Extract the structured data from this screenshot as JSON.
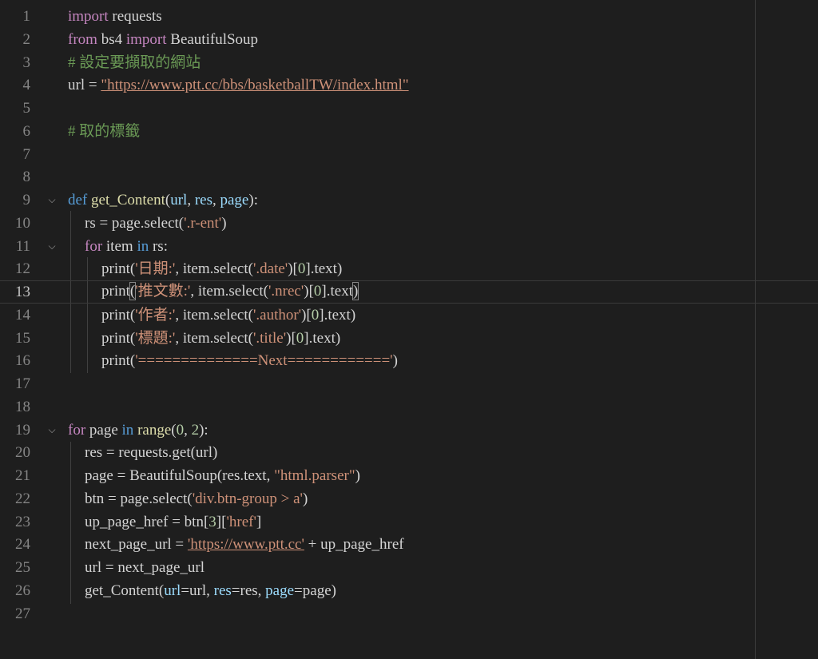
{
  "editor": {
    "lines": [
      {
        "n": "1",
        "fold": false,
        "indent": 0,
        "tokens": [
          [
            "kw",
            "import"
          ],
          [
            "",
            " requests"
          ]
        ]
      },
      {
        "n": "2",
        "fold": false,
        "indent": 0,
        "tokens": [
          [
            "kw",
            "from"
          ],
          [
            "",
            " bs4 "
          ],
          [
            "kw",
            "import"
          ],
          [
            "",
            " BeautifulSoup"
          ]
        ]
      },
      {
        "n": "3",
        "fold": false,
        "indent": 0,
        "tokens": [
          [
            "cmt",
            "# 設定要擷取的網站"
          ]
        ]
      },
      {
        "n": "4",
        "fold": false,
        "indent": 0,
        "tokens": [
          [
            "",
            "url = "
          ],
          [
            "str link",
            "\"https://www.ptt.cc/bbs/basketballTW/index.html\""
          ]
        ]
      },
      {
        "n": "5",
        "fold": false,
        "indent": 0,
        "tokens": []
      },
      {
        "n": "6",
        "fold": false,
        "indent": 0,
        "tokens": [
          [
            "cmt",
            "# 取的標籤"
          ]
        ]
      },
      {
        "n": "7",
        "fold": false,
        "indent": 0,
        "tokens": []
      },
      {
        "n": "8",
        "fold": false,
        "indent": 0,
        "tokens": []
      },
      {
        "n": "9",
        "fold": true,
        "indent": 0,
        "tokens": [
          [
            "kb",
            "def"
          ],
          [
            "",
            " "
          ],
          [
            "fn",
            "get_Content"
          ],
          [
            "",
            "("
          ],
          [
            "var",
            "url"
          ],
          [
            "",
            ", "
          ],
          [
            "var",
            "res"
          ],
          [
            "",
            ", "
          ],
          [
            "var",
            "page"
          ],
          [
            "",
            "):"
          ]
        ]
      },
      {
        "n": "10",
        "fold": false,
        "indent": 1,
        "tokens": [
          [
            "",
            "rs = page.select("
          ],
          [
            "str",
            "'.r-ent'"
          ],
          [
            "",
            ")"
          ]
        ]
      },
      {
        "n": "11",
        "fold": true,
        "indent": 1,
        "tokens": [
          [
            "kw",
            "for"
          ],
          [
            "",
            " item "
          ],
          [
            "kb",
            "in"
          ],
          [
            "",
            " rs:"
          ]
        ]
      },
      {
        "n": "12",
        "fold": false,
        "indent": 2,
        "tokens": [
          [
            "",
            "print("
          ],
          [
            "str",
            "'日期:'"
          ],
          [
            "",
            ", item.select("
          ],
          [
            "str",
            "'.date'"
          ],
          [
            "",
            ")["
          ],
          [
            "num",
            "0"
          ],
          [
            "",
            "].text)"
          ]
        ]
      },
      {
        "n": "13",
        "fold": false,
        "indent": 2,
        "current": true,
        "tokens": [
          [
            "",
            "print"
          ],
          [
            "br cursor-br",
            "("
          ],
          [
            "str",
            "'推文數:'"
          ],
          [
            "",
            ", item.select("
          ],
          [
            "str",
            "'.nrec'"
          ],
          [
            "",
            ")["
          ],
          [
            "num",
            "0"
          ],
          [
            "",
            "].text"
          ],
          [
            "br cursor-br",
            ")"
          ]
        ]
      },
      {
        "n": "14",
        "fold": false,
        "indent": 2,
        "tokens": [
          [
            "",
            "print("
          ],
          [
            "str",
            "'作者:'"
          ],
          [
            "",
            ", item.select("
          ],
          [
            "str",
            "'.author'"
          ],
          [
            "",
            ")["
          ],
          [
            "num",
            "0"
          ],
          [
            "",
            "].text)"
          ]
        ]
      },
      {
        "n": "15",
        "fold": false,
        "indent": 2,
        "tokens": [
          [
            "",
            "print("
          ],
          [
            "str",
            "'標題:'"
          ],
          [
            "",
            ", item.select("
          ],
          [
            "str",
            "'.title'"
          ],
          [
            "",
            ")["
          ],
          [
            "num",
            "0"
          ],
          [
            "",
            "].text)"
          ]
        ]
      },
      {
        "n": "16",
        "fold": false,
        "indent": 2,
        "tokens": [
          [
            "",
            "print("
          ],
          [
            "str",
            "'==============Next============'"
          ],
          [
            "",
            ")"
          ]
        ]
      },
      {
        "n": "17",
        "fold": false,
        "indent": 0,
        "tokens": []
      },
      {
        "n": "18",
        "fold": false,
        "indent": 0,
        "tokens": []
      },
      {
        "n": "19",
        "fold": true,
        "indent": 0,
        "tokens": [
          [
            "kw",
            "for"
          ],
          [
            "",
            " page "
          ],
          [
            "kb",
            "in"
          ],
          [
            "",
            " "
          ],
          [
            "fn",
            "range"
          ],
          [
            "",
            "("
          ],
          [
            "num",
            "0"
          ],
          [
            "",
            ", "
          ],
          [
            "num",
            "2"
          ],
          [
            "",
            "):"
          ]
        ]
      },
      {
        "n": "20",
        "fold": false,
        "indent": 1,
        "tokens": [
          [
            "",
            "res = requests.get(url)"
          ]
        ]
      },
      {
        "n": "21",
        "fold": false,
        "indent": 1,
        "tokens": [
          [
            "",
            "page = BeautifulSoup(res.text, "
          ],
          [
            "str",
            "\"html.parser\""
          ],
          [
            "",
            ")"
          ]
        ]
      },
      {
        "n": "22",
        "fold": false,
        "indent": 1,
        "tokens": [
          [
            "",
            "btn = page.select("
          ],
          [
            "str",
            "'div.btn-group > a'"
          ],
          [
            "",
            ")"
          ]
        ]
      },
      {
        "n": "23",
        "fold": false,
        "indent": 1,
        "tokens": [
          [
            "",
            "up_page_href = btn["
          ],
          [
            "num",
            "3"
          ],
          [
            "",
            "]["
          ],
          [
            "str",
            "'href'"
          ],
          [
            "",
            "]"
          ]
        ]
      },
      {
        "n": "24",
        "fold": false,
        "indent": 1,
        "tokens": [
          [
            "",
            "next_page_url = "
          ],
          [
            "str link",
            "'https://www.ptt.cc'"
          ],
          [
            "",
            " + up_page_href"
          ]
        ]
      },
      {
        "n": "25",
        "fold": false,
        "indent": 1,
        "tokens": [
          [
            "",
            "url = next_page_url"
          ]
        ]
      },
      {
        "n": "26",
        "fold": false,
        "indent": 1,
        "tokens": [
          [
            "",
            "get_Content("
          ],
          [
            "var",
            "url"
          ],
          [
            "",
            "=url, "
          ],
          [
            "var",
            "res"
          ],
          [
            "",
            "=res, "
          ],
          [
            "var",
            "page"
          ],
          [
            "",
            "=page)"
          ]
        ]
      },
      {
        "n": "27",
        "fold": false,
        "indent": 0,
        "tokens": []
      }
    ],
    "fold_glyph": "⌵"
  }
}
